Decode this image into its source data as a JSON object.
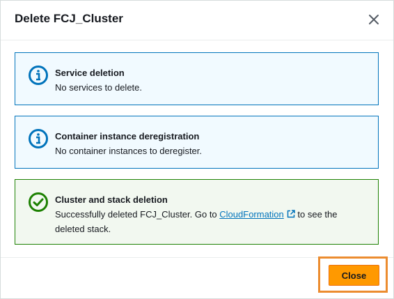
{
  "modal": {
    "title": "Delete FCJ_Cluster",
    "close_icon": "close-icon"
  },
  "alerts": [
    {
      "type": "info",
      "icon": "info-icon",
      "title": "Service deletion",
      "text": "No services to delete."
    },
    {
      "type": "info",
      "icon": "info-icon",
      "title": "Container instance deregistration",
      "text": "No container instances to deregister."
    },
    {
      "type": "success",
      "icon": "check-circle-icon",
      "title": "Cluster and stack deletion",
      "text_before": "Successfully deleted FCJ_Cluster. Go to ",
      "link_label": "CloudFormation",
      "link_icon": "external-link-icon",
      "text_after": " to see the deleted stack."
    }
  ],
  "footer": {
    "close_label": "Close"
  },
  "colors": {
    "info_border": "#0073bb",
    "info_background": "#f1faff",
    "success_border": "#1d8102",
    "success_background": "#f2f8f0",
    "primary_button": "#ff9900",
    "highlight": "#ec8c2f"
  }
}
